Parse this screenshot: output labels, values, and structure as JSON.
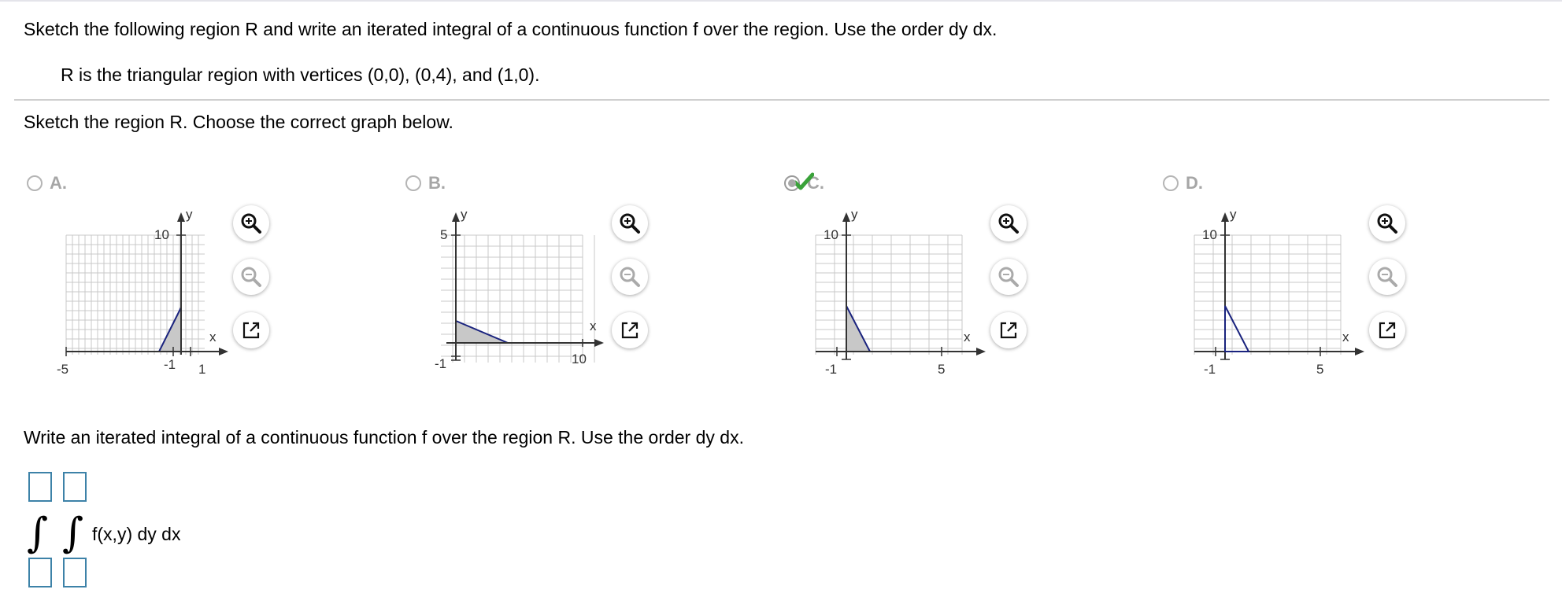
{
  "problem": {
    "instruction": "Sketch the following region R and write an iterated integral of a continuous function f over the region. Use the order dy dx.",
    "region": "R is the triangular region with vertices (0,0), (0,4), and (1,0)."
  },
  "part1": {
    "prompt": "Sketch the region R. Choose the correct graph below.",
    "choices": [
      {
        "letter": "A.",
        "selected": false,
        "y_tick": "10",
        "x_min_label": "-5",
        "x_max_label": "1",
        "origin_label": "-1",
        "x_axis_label": "x",
        "y_axis_label": "y"
      },
      {
        "letter": "B.",
        "selected": false,
        "y_tick": "5",
        "x_max_label": "10",
        "origin_label": "-1",
        "x_axis_label": "x",
        "y_axis_label": "y"
      },
      {
        "letter": "C.",
        "selected": true,
        "y_tick": "10",
        "x_max_label": "5",
        "origin_label": "-1",
        "x_axis_label": "x",
        "y_axis_label": "y"
      },
      {
        "letter": "D.",
        "selected": false,
        "y_tick": "10",
        "x_max_label": "5",
        "origin_label": "-1",
        "x_axis_label": "x",
        "y_axis_label": "y"
      }
    ],
    "tool_icons": [
      "zoom-in-icon",
      "zoom-out-icon",
      "open-new-window-icon"
    ]
  },
  "part2": {
    "prompt": "Write an iterated integral of a continuous function f over the region R. Use the order dy dx.",
    "integrand": "f(x,y) dy dx",
    "outer_upper": "",
    "inner_upper": "",
    "outer_lower": "",
    "inner_lower": ""
  },
  "colors": {
    "region_fill": "#c8c8c8",
    "region_stroke": "#1a237e",
    "box_border": "#3d82a8",
    "check": "#3aa23a"
  }
}
